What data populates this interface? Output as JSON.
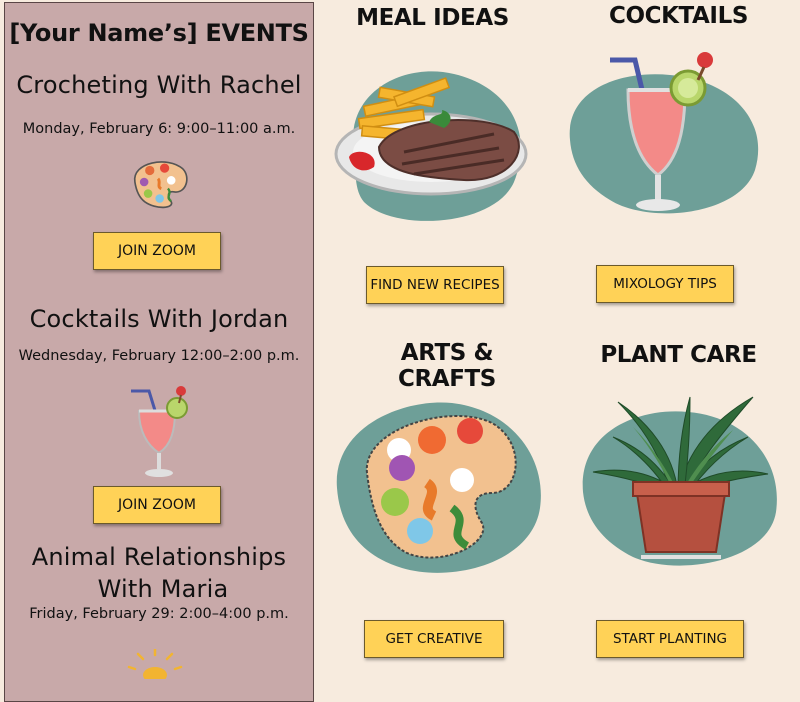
{
  "sidebar": {
    "title": "[Your Name’s]  EVENTS",
    "events": [
      {
        "title": "Crocheting With Rachel",
        "date": "Monday, February 6: 9:00–11:00 a.m.",
        "button": "JOIN ZOOM",
        "icon": "palette-icon"
      },
      {
        "title": "Cocktails With Jordan",
        "date": "Wednesday, February  12:00–2:00 p.m.",
        "button": "JOIN ZOOM",
        "icon": "cocktail-icon"
      },
      {
        "title_line1": "Animal Relationships",
        "title_line2": "With Maria",
        "date": "Friday, February 29: 2:00–4:00 p.m.",
        "icon": "sun-icon"
      }
    ]
  },
  "cards": [
    {
      "title": "MEAL IDEAS",
      "button": "FIND NEW RECIPES",
      "icon": "steak-fries-icon"
    },
    {
      "title": "COCKTAILS",
      "button": "MIXOLOGY TIPS",
      "icon": "cocktail-icon"
    },
    {
      "title": "ARTS & CRAFTS",
      "button": "GET CREATIVE",
      "icon": "palette-icon"
    },
    {
      "title": "PLANT CARE",
      "button": "START PLANTING",
      "icon": "potted-plant-icon"
    }
  ],
  "colors": {
    "page_background": "#f7ebde",
    "sidebar_background": "#c8a9a9",
    "button_yellow": "#ffd257",
    "blob_green": "#6e9f98"
  }
}
